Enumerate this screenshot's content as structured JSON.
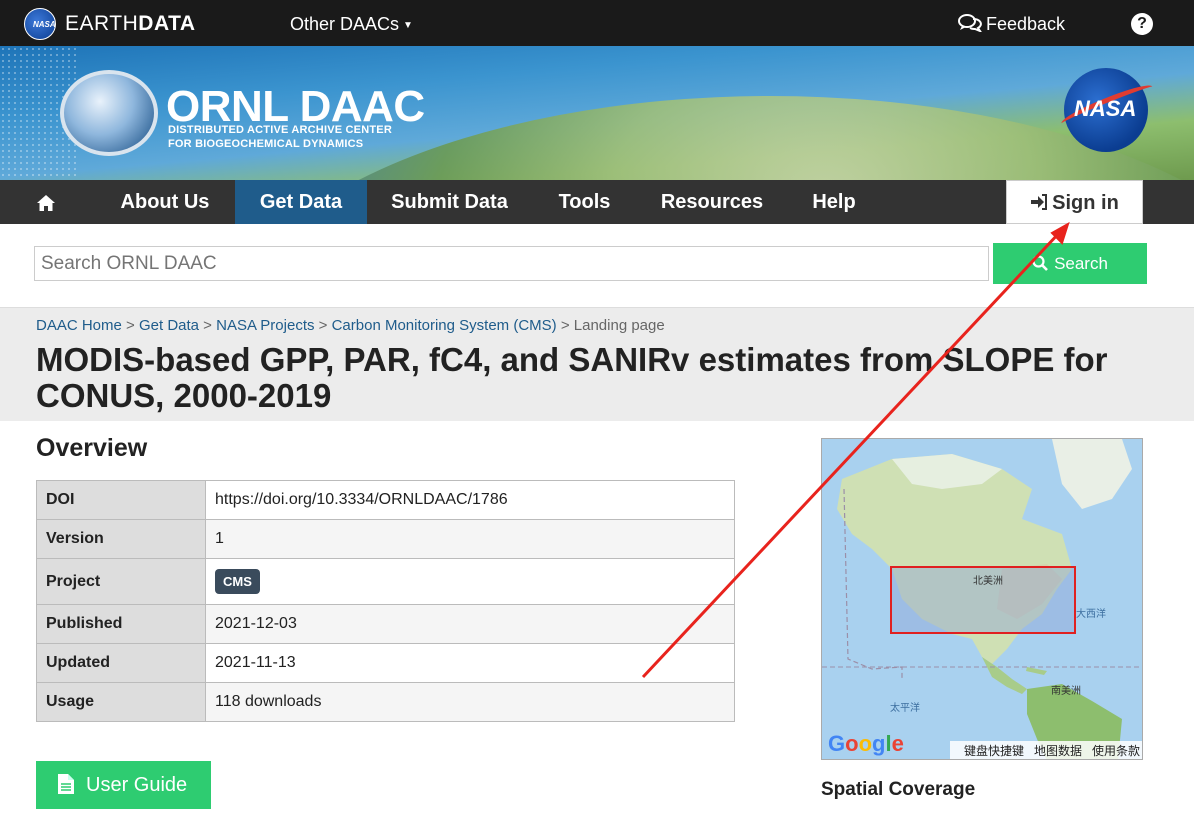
{
  "earthdata": {
    "brand_light": "EARTH",
    "brand_bold": "DATA",
    "logo_text": "NASA",
    "other_daacs": "Other DAACs",
    "feedback": "Feedback",
    "help": "?"
  },
  "banner": {
    "title": "ORNL DAAC",
    "subtitle_line1": "DISTRIBUTED ACTIVE ARCHIVE CENTER",
    "subtitle_line2": "FOR BIOGEOCHEMICAL DYNAMICS",
    "nasa_logo": "NASA"
  },
  "nav": {
    "about": "About Us",
    "get_data": "Get Data",
    "submit_data": "Submit Data",
    "tools": "Tools",
    "resources": "Resources",
    "help": "Help",
    "sign_in": "Sign in"
  },
  "search": {
    "placeholder": "Search ORNL DAAC",
    "button": "Search"
  },
  "breadcrumb": {
    "items": [
      "DAAC Home",
      "Get Data",
      "NASA Projects",
      "Carbon Monitoring System (CMS)"
    ],
    "current": "Landing page",
    "separator": " > "
  },
  "page": {
    "title": "MODIS-based GPP, PAR, fC4, and SANIRv estimates from SLOPE for CONUS, 2000-2019"
  },
  "overview": {
    "heading": "Overview",
    "rows": [
      {
        "key": "DOI",
        "value": "https://doi.org/10.3334/ORNLDAAC/1786"
      },
      {
        "key": "Version",
        "value": "1"
      },
      {
        "key": "Project",
        "value": "CMS"
      },
      {
        "key": "Published",
        "value": "2021-12-03"
      },
      {
        "key": "Updated",
        "value": "2021-11-13"
      },
      {
        "key": "Usage",
        "value": "118 downloads"
      }
    ]
  },
  "user_guide": "User Guide",
  "map": {
    "labels": {
      "north_america": "北美洲",
      "atlantic": "大西洋",
      "pacific": "太平洋",
      "south_america": "南美洲"
    },
    "google": "Google",
    "links": [
      "键盘快捷键",
      "地图数据",
      "使用条款"
    ]
  },
  "spatial_coverage": "Spatial Coverage",
  "colors": {
    "green": "#2ecc71",
    "nav_dark": "#333333",
    "nav_active": "#1f5c8b",
    "annotation_red": "#e8231d"
  }
}
